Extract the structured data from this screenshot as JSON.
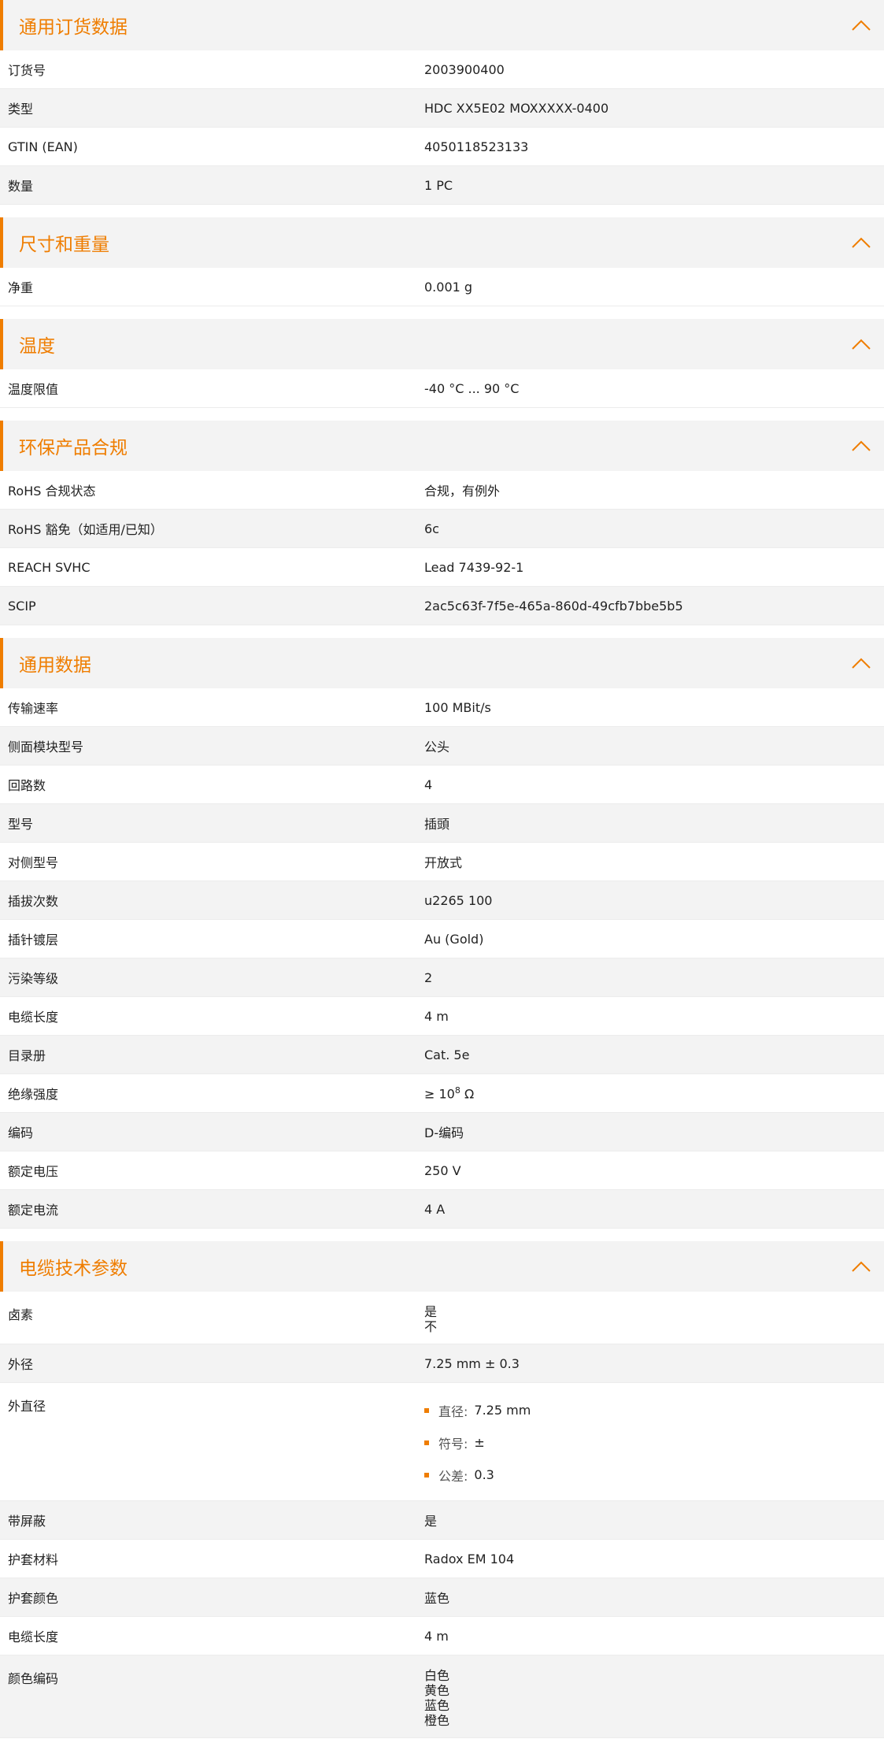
{
  "colors": {
    "accent": "#ef7d00",
    "stripe": "#f3f3f3"
  },
  "icons": {
    "collapse": "chevron-up-icon",
    "bullet": "square-bullet-icon"
  },
  "sections": [
    {
      "title": "通用订货数据",
      "rows": [
        {
          "label": "订货号",
          "value": "2003900400"
        },
        {
          "label": "类型",
          "value": "HDC XX5E02 MOXXXXX-0400"
        },
        {
          "label": "GTIN (EAN)",
          "value": "4050118523133"
        },
        {
          "label": "数量",
          "value": "1  PC"
        }
      ]
    },
    {
      "title": "尺寸和重量",
      "rows": [
        {
          "label": "净重",
          "value": "0.001  g"
        }
      ]
    },
    {
      "title": "温度",
      "rows": [
        {
          "label": "温度限值",
          "value": "-40 °C ... 90 °C"
        }
      ]
    },
    {
      "title": "环保产品合规",
      "rows": [
        {
          "label": "RoHS 合规状态",
          "value": "合规，有例外"
        },
        {
          "label": "RoHS 豁免（如适用/已知）",
          "value": "6c"
        },
        {
          "label": "REACH SVHC",
          "value": "Lead 7439-92-1"
        },
        {
          "label": "SCIP",
          "value": "2ac5c63f-7f5e-465a-860d-49cfb7bbe5b5"
        }
      ]
    },
    {
      "title": "通用数据",
      "rows": [
        {
          "label": "传输速率",
          "value": "100 MBit/s"
        },
        {
          "label": "侧面模块型号",
          "value": "公头"
        },
        {
          "label": "回路数",
          "value": "4"
        },
        {
          "label": "型号",
          "value": "插頭"
        },
        {
          "label": "对侧型号",
          "value": "开放式"
        },
        {
          "label": "插拔次数",
          "value": "u2265 100"
        },
        {
          "label": "插针镀层",
          "value": "Au (Gold)"
        },
        {
          "label": "污染等级",
          "value": "2"
        },
        {
          "label": "电缆长度",
          "value": "4  m"
        },
        {
          "label": "目录册",
          "value": "Cat. 5e"
        },
        {
          "label": "绝缘强度",
          "value": "≥ 10",
          "sup": "8",
          "suffix": " Ω"
        },
        {
          "label": "编码",
          "value": "D-编码"
        },
        {
          "label": "额定电压",
          "value": "250  V"
        },
        {
          "label": "额定电流",
          "value": "4  A"
        }
      ]
    },
    {
      "title": "电缆技术参数",
      "rows": [
        {
          "label": "卤素",
          "lines": [
            "是",
            "不"
          ]
        },
        {
          "label": "外径",
          "value": "7.25 mm ± 0.3"
        },
        {
          "label": "外直径",
          "bullets": [
            {
              "key": "直径:",
              "value": "7.25 mm"
            },
            {
              "key": "符号:",
              "value": "±"
            },
            {
              "key": "公差:",
              "value": "0.3"
            }
          ]
        },
        {
          "label": "带屏蔽",
          "value": "是"
        },
        {
          "label": "护套材料",
          "value": "Radox EM 104"
        },
        {
          "label": "护套颜色",
          "value": "蓝色"
        },
        {
          "label": "电缆长度",
          "value": "4  m"
        },
        {
          "label": "颜色编码",
          "lines": [
            "白色",
            "黄色",
            "蓝色",
            "橙色"
          ]
        }
      ]
    }
  ]
}
